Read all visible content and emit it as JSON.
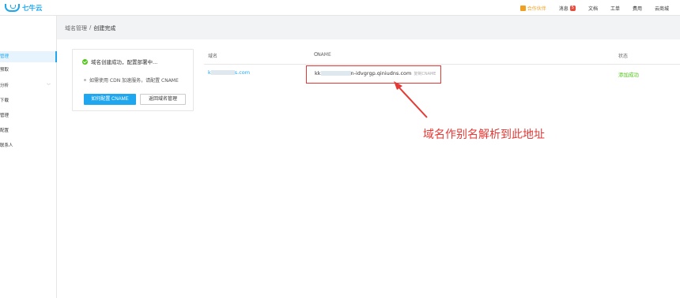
{
  "header": {
    "logo_text": "七牛云",
    "nav": [
      {
        "label": "合作伙伴"
      },
      {
        "label": "消息",
        "badge": "5"
      },
      {
        "label": "文档"
      },
      {
        "label": "工单"
      },
      {
        "label": "费用"
      },
      {
        "label": "云商城"
      }
    ]
  },
  "sidebar": {
    "items": [
      {
        "label": "管理",
        "active": true
      },
      {
        "label": "预取",
        "active": false
      },
      {
        "label": "分析",
        "active": false,
        "expandable": true
      },
      {
        "label": "下载",
        "active": false
      },
      {
        "label": "管理",
        "active": false
      },
      {
        "label": "配置",
        "active": false
      },
      {
        "label": "联系人",
        "active": false
      }
    ]
  },
  "breadcrumb": {
    "parent": "域名管理",
    "separator": "/",
    "current": "创建完成"
  },
  "status_card": {
    "title": "域名创建成功，配置部署中...",
    "hint": "如需使用 CDN 加速服务，请配置 CNAME",
    "primary_button": "如何配置 CNAME",
    "secondary_button": "返回域名管理"
  },
  "table": {
    "headers": {
      "domain": "域名",
      "cname": "CNAME",
      "status": "状态"
    },
    "row": {
      "domain_prefix": "k",
      "domain_suffix": "s.com",
      "cname_prefix": "kk",
      "cname_suffix": "n-idvgrgp.qiniudns.com",
      "copy_label": "复制CNAME",
      "status": "添加成功"
    }
  },
  "annotation": {
    "text": "域名作别名解析到此地址",
    "color": "#e53935"
  },
  "colors": {
    "accent": "#1ea7ef",
    "success": "#52c41a",
    "annotation": "#e53935"
  }
}
